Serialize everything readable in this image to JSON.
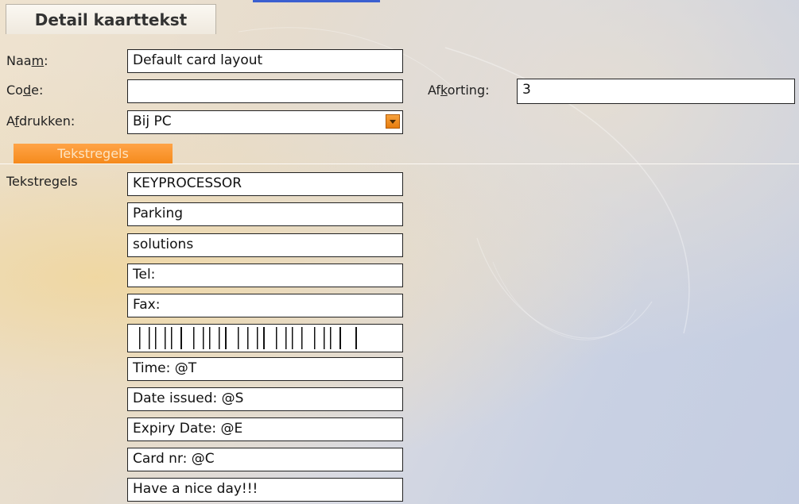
{
  "header": {
    "title": "Detail kaarttekst"
  },
  "form": {
    "name_label_pre": "Naa",
    "name_label_key": "m",
    "name_label_post": ":",
    "name_value": "Default card layout",
    "code_label_pre": "Co",
    "code_label_key": "d",
    "code_label_post": "e:",
    "code_value": "",
    "abbrev_label_pre": "Af",
    "abbrev_label_key": "k",
    "abbrev_label_post": "orting:",
    "abbrev_value": "3",
    "print_label_pre": "A",
    "print_label_key": "f",
    "print_label_post": "drukken:",
    "print_value": "Bij PC"
  },
  "section": {
    "tab_label": "Tekstregels",
    "lines_label": "Tekstregels"
  },
  "lines": [
    "KEYPROCESSOR",
    "Parking",
    "solutions",
    "Tel:",
    "Fax:",
    "",
    "Time: @T",
    "Date issued: @S",
    "Expiry Date: @E",
    "Card nr: @C",
    "Have a nice day!!!"
  ],
  "icons": {
    "dropdown": "chevron-down-icon",
    "barcode": "barcode-icon"
  },
  "colors": {
    "accent": "#f58a1c",
    "field_border": "#222222"
  }
}
